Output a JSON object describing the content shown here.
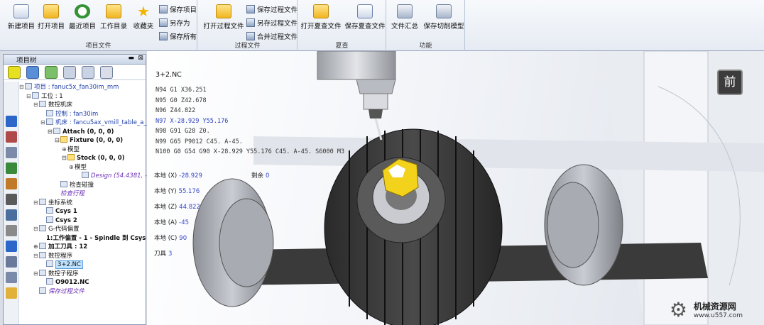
{
  "ribbon": {
    "groups": [
      {
        "label": "项目文件"
      },
      {
        "label": "过程文件"
      },
      {
        "label": "夏查"
      },
      {
        "label": "功能"
      }
    ],
    "buttons": {
      "new_project": "新建项目",
      "open_project": "打开项目",
      "recent_project": "最近项目",
      "work_dir": "工作目录",
      "favorites": "收藏夹",
      "save_project": "保存项目",
      "save_as": "另存为",
      "save_all": "保存所有",
      "open_process": "打开过程文件",
      "save_process": "保存过程文件",
      "save_process_as": "另存过程文件",
      "merge_process": "合并过程文件",
      "open_review": "打开夏查文件",
      "save_review": "保存夏查文件",
      "file_summary": "文件汇总",
      "save_cut_model": "保存切削模型"
    }
  },
  "panel": {
    "title": "项目树",
    "pin": "▬",
    "close": "⊠"
  },
  "tree": [
    {
      "text": "项目 : fanuc5x_fan30im_mm",
      "cls": "blue",
      "icon": "doc",
      "tog": "⊟"
    },
    {
      "text": "工位 : 1",
      "cls": "",
      "icon": "doc",
      "tog": "⊟"
    },
    {
      "text": "数控机床",
      "cls": "",
      "icon": "doc",
      "tog": "⊟"
    },
    {
      "text": "控制 : fan30im",
      "cls": "blue",
      "icon": "doc",
      "tog": ""
    },
    {
      "text": "机床 : fancu5ax_vmill_table_a_t",
      "cls": "blue",
      "icon": "doc",
      "tog": "⊟"
    },
    {
      "text": "Attach (0, 0, 0)",
      "cls": "bold",
      "icon": "doc",
      "tog": "⊟"
    },
    {
      "text": "Fixture (0, 0, 0)",
      "cls": "bold",
      "icon": "yellow",
      "tog": "⊟"
    },
    {
      "text": "模型",
      "cls": "",
      "icon": "",
      "tog": "⊕"
    },
    {
      "text": "Stock (0, 0, 0)",
      "cls": "bold",
      "icon": "yellow",
      "tog": "⊟"
    },
    {
      "text": "模型",
      "cls": "",
      "icon": "",
      "tog": "⊕"
    },
    {
      "text": "Design (54.4381, -",
      "cls": "purple",
      "icon": "doc",
      "tog": ""
    },
    {
      "text": "检查碰撞",
      "cls": "",
      "icon": "doc",
      "tog": ""
    },
    {
      "text": "检查行程",
      "cls": "purple",
      "icon": "",
      "tog": ""
    },
    {
      "text": "坐标系统",
      "cls": "",
      "icon": "doc",
      "tog": "⊟"
    },
    {
      "text": "Csys 1",
      "cls": "bold",
      "icon": "doc",
      "tog": ""
    },
    {
      "text": "Csys 2",
      "cls": "bold",
      "icon": "doc",
      "tog": ""
    },
    {
      "text": "G-代码偏置",
      "cls": "",
      "icon": "doc",
      "tog": "⊟"
    },
    {
      "text": "1:工作偏置 - 1 - Spindle 到 Csys 1",
      "cls": "bold",
      "icon": "",
      "tog": ""
    },
    {
      "text": "加工刀具 : 12",
      "cls": "bold",
      "icon": "doc",
      "tog": "⊕"
    },
    {
      "text": "数控程序",
      "cls": "",
      "icon": "doc",
      "tog": "⊟"
    },
    {
      "text": "3+2.NC",
      "cls": "hl",
      "icon": "doc",
      "tog": ""
    },
    {
      "text": "数控子程序",
      "cls": "",
      "icon": "doc",
      "tog": "⊟"
    },
    {
      "text": "O9012.NC",
      "cls": "bold",
      "icon": "doc",
      "tog": ""
    },
    {
      "text": "保存过程文件",
      "cls": "purple",
      "icon": "doc",
      "tog": ""
    }
  ],
  "viewport": {
    "program_name": "3+2.NC",
    "nc_lines": [
      {
        "text": "N94 G1 X36.251",
        "cls": ""
      },
      {
        "text": "N95 G0 Z42.678",
        "cls": ""
      },
      {
        "text": "N96 Z44.822",
        "cls": ""
      },
      {
        "text": "N97 X-28.929 Y55.176",
        "cls": "blue"
      },
      {
        "text": "N98 G91 G28 Z0.",
        "cls": ""
      },
      {
        "text": "N99 G65 P9012 C45. A-45.",
        "cls": ""
      },
      {
        "text": "N100 G0 G54 G90 X-28.929 Y55.176 C45. A-45. S6000 M3",
        "cls": ""
      }
    ],
    "positions": [
      {
        "label": "本地 (X)",
        "value": "-28.929"
      },
      {
        "label": "本地 (Y)",
        "value": "55.176"
      },
      {
        "label": "本地 (Z)",
        "value": "44.822"
      },
      {
        "label": "本地 (A)",
        "value": "-45"
      },
      {
        "label": "本地 (C)",
        "value": "90"
      }
    ],
    "remaining_label": "剩余",
    "remaining_value": "0",
    "tool_label": "刀具",
    "tool_value": "3",
    "view_cube": "前"
  },
  "watermark": {
    "name": "机械资源网",
    "url": "www.u557.com"
  },
  "colors": {
    "accent": "#3a6fd8",
    "nc_blue": "#2a3fbf",
    "part_yellow": "#f2d21a"
  }
}
